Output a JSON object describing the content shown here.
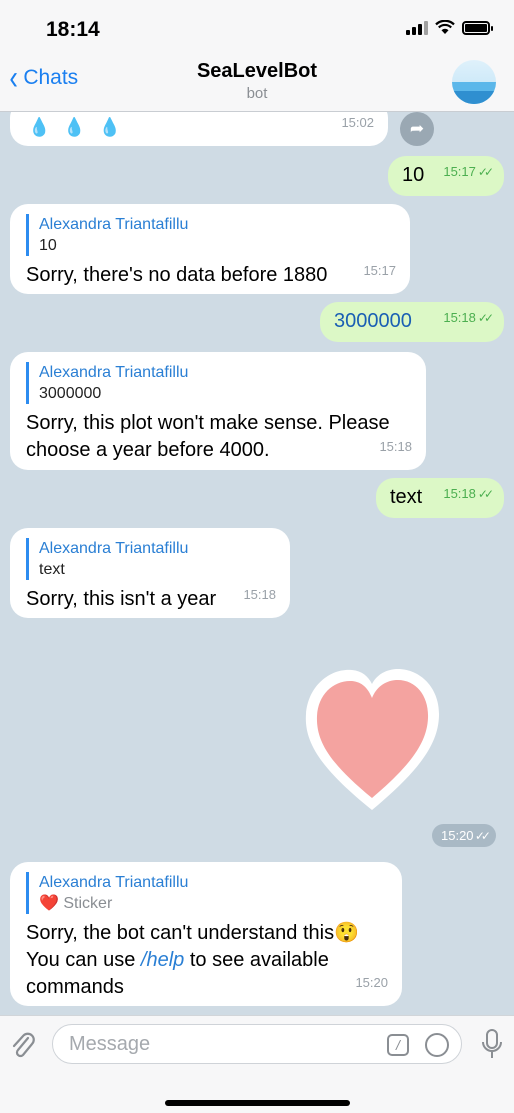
{
  "status_bar": {
    "time": "18:14"
  },
  "header": {
    "back_label": "Chats",
    "title": "SeaLevelBot",
    "subtitle": "bot"
  },
  "messages": [
    {
      "kind": "in",
      "text": "💧 💧 💧",
      "time": "15:02"
    },
    {
      "kind": "out",
      "text": "10",
      "time": "15:17"
    },
    {
      "kind": "in",
      "reply_author": "Alexandra Triantafillu",
      "reply_text": "10",
      "text": "Sorry, there's no data before 1880",
      "time": "15:17"
    },
    {
      "kind": "out",
      "text": "3000000",
      "time": "15:18"
    },
    {
      "kind": "in",
      "reply_author": "Alexandra Triantafillu",
      "reply_text": "3000000",
      "line1": "Sorry, this plot won't make sense. Please",
      "line2": "choose a year before 4000.",
      "time": "15:18"
    },
    {
      "kind": "out",
      "text": "text",
      "time": "15:18"
    },
    {
      "kind": "in",
      "reply_author": "Alexandra Triantafillu",
      "reply_text": "text",
      "text": "Sorry, this isn't a year",
      "time": "15:18"
    },
    {
      "kind": "sticker",
      "time": "15:20"
    },
    {
      "kind": "in",
      "reply_author": "Alexandra Triantafillu",
      "reply_emoji": "❤️",
      "reply_text": "Sticker",
      "line1": "Sorry, the bot can't understand this😲",
      "line2_pre": "You can use",
      "line2_cmd": "/help",
      "line2_post": "to see available",
      "line3": "commands",
      "time": "15:20"
    }
  ],
  "input": {
    "placeholder": "Message"
  },
  "colors": {
    "accent": "#1a7ff0",
    "outgoing_bubble": "#dcf8c6",
    "incoming_bubble": "#ffffff",
    "chat_background": "#cfdbe4",
    "sticker_heart": "#f4a3a0"
  }
}
